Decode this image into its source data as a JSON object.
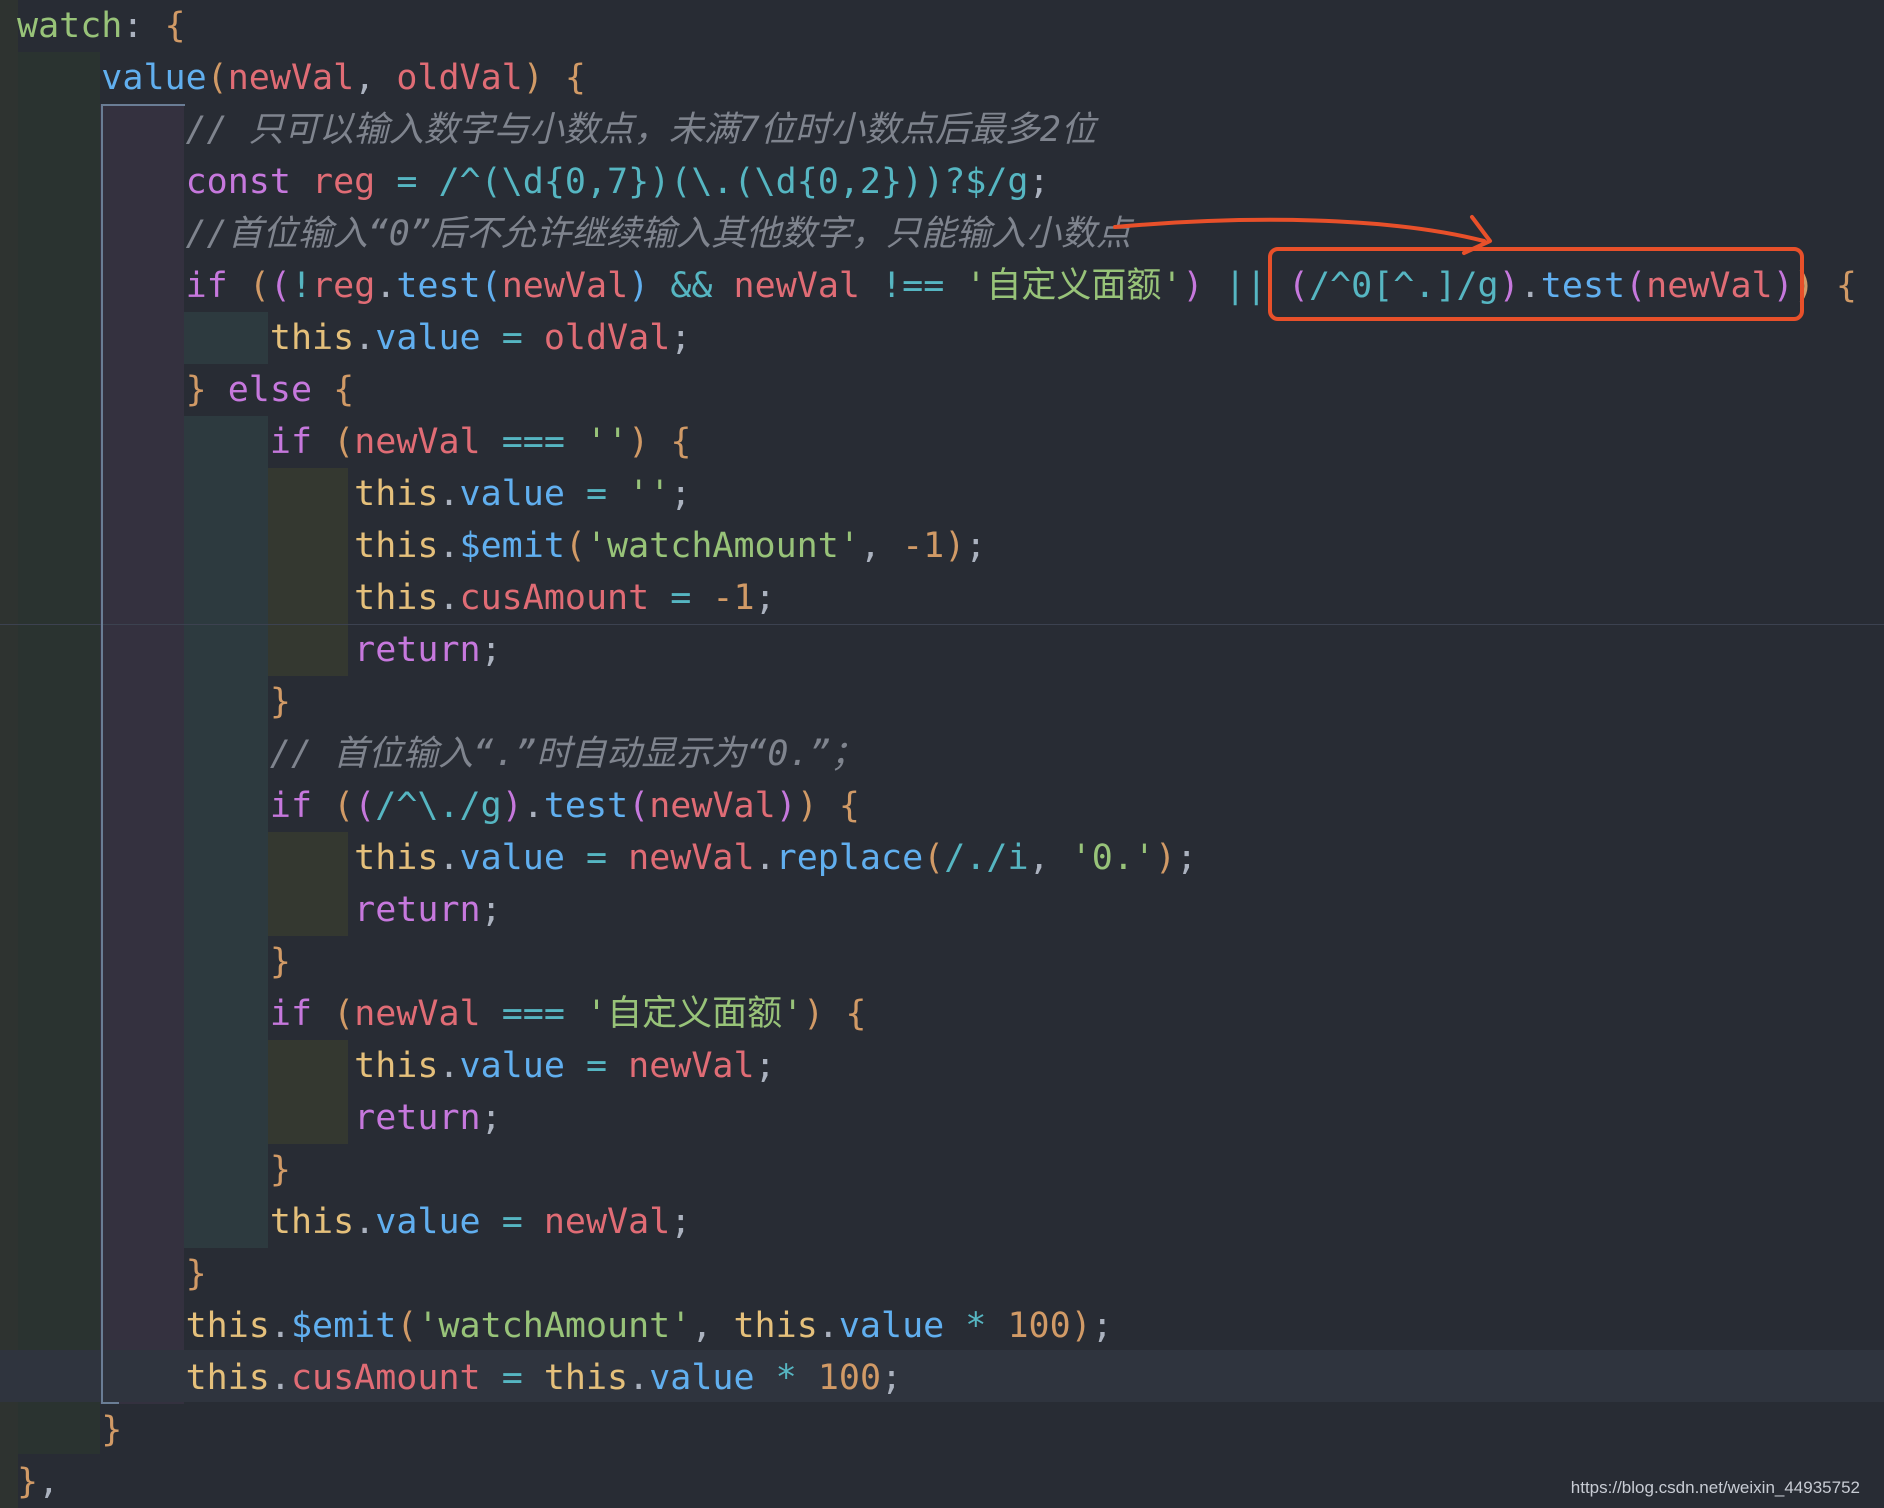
{
  "editor": {
    "language": "javascript",
    "theme": "one-dark",
    "lines": [
      "watch: {",
      "    value(newVal, oldVal) {",
      "        // 只可以输入数字与小数点，未满7位时小数点后最多2位",
      "        const reg = /^(\\d{0,7})(\\.(\\d{0,2}))?$/g;",
      "        //首位输入“0”后不允许继续输入其他数字，只能输入小数点",
      "        if ((!reg.test(newVal) && newVal !== '自定义面额') || (/^0[^.]/g).test(newVal)) {",
      "            this.value = oldVal;",
      "        } else {",
      "            if (newVal === '') {",
      "                this.value = '';",
      "                this.$emit('watchAmount', -1);",
      "                this.cusAmount = -1;",
      "                return;",
      "            }",
      "            // 首位输入“.”时自动显示为“0.”；",
      "            if ((/^\\./g).test(newVal)) {",
      "                this.value = newVal.replace(/./i, '0.');",
      "                return;",
      "            }",
      "            if (newVal === '自定义面额') {",
      "                this.value = newVal;",
      "                return;",
      "            }",
      "            this.value = newVal;",
      "        }",
      "        this.$emit('watchAmount', this.value * 100);",
      "        this.cusAmount = this.value * 100;",
      "    }",
      "},"
    ]
  },
  "annotation": {
    "highlighted_code": "(/^0[^.]/g).test(newVal))",
    "color": "#e8502a"
  },
  "watermark": "https://blog.csdn.net/weixin_44935752"
}
